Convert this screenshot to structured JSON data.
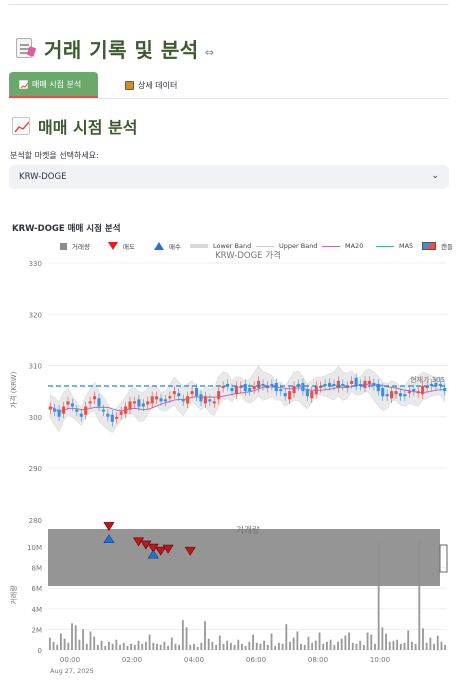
{
  "page": {
    "title": "거래 기록 및 분석",
    "title_link_icon": "link-icon"
  },
  "tabs": [
    {
      "label": "매매 시점 분석",
      "icon": "chart-up-icon",
      "active": true
    },
    {
      "label": "상세 데이터",
      "icon": "card-box-icon",
      "active": false
    }
  ],
  "section": {
    "heading": "매매 시점 분석",
    "icon": "chart-up-icon"
  },
  "market_select": {
    "label": "분석할 마켓을 선택하세요:",
    "value": "KRW-DOGE"
  },
  "chart": {
    "header": "KRW-DOGE 매매 시점 분석",
    "legend": [
      {
        "label": "거래량",
        "kind": "square",
        "color": "#8c8c8c"
      },
      {
        "label": "매도",
        "kind": "down-triangle",
        "color": "#e02020"
      },
      {
        "label": "매수",
        "kind": "up-triangle",
        "color": "#2a6fd6"
      },
      {
        "label": "Lower Band",
        "kind": "band",
        "color": "#d9d9d9"
      },
      {
        "label": "Upper Band",
        "kind": "line",
        "color": "#cccccc"
      },
      {
        "label": "MA20",
        "kind": "line",
        "color": "#b86cc7"
      },
      {
        "label": "MA5",
        "kind": "line",
        "color": "#4ab0a8"
      },
      {
        "label": "캔들",
        "kind": "candle",
        "color": "#2a6fd6"
      }
    ],
    "colors": {
      "up": "#e8514a",
      "down": "#3a8ee6",
      "current_price_line": "#2a82d4",
      "band_fill": "#e4e4e4",
      "volume_bar": "#9a9a9a",
      "volume_overlay": "#8f8f8f"
    }
  },
  "chart_data": [
    {
      "type": "candlestick",
      "title": "KRW-DOGE 가격",
      "ylabel": "가격 (KRW)",
      "ylim": [
        285,
        332
      ],
      "yticks": [
        290,
        300,
        310,
        320,
        330
      ],
      "current_price_label": "현재가 305",
      "current_price": 306,
      "series_close": [
        302,
        301,
        300,
        302,
        303,
        302,
        301,
        300,
        302,
        303,
        304,
        302,
        301,
        300,
        299,
        300,
        301,
        302,
        303,
        303,
        302,
        302,
        303,
        304,
        304,
        303,
        303,
        304,
        305,
        304,
        303,
        304,
        305,
        304,
        303,
        304,
        303,
        303,
        305,
        306,
        306,
        305,
        306,
        306,
        305,
        305,
        306,
        307,
        306,
        306,
        306,
        305,
        305,
        304,
        305,
        306,
        306,
        305,
        304,
        305,
        306,
        306,
        306,
        306,
        306,
        307,
        306,
        306,
        307,
        306,
        306,
        307,
        307,
        306,
        305,
        304,
        304,
        305,
        305,
        304,
        304,
        305,
        305,
        305,
        306,
        306,
        306,
        306,
        306,
        305
      ]
    },
    {
      "type": "bar",
      "title": "거래량",
      "ylabel": "거래량",
      "yticks": [
        "0",
        "2M",
        "4M",
        "6M",
        "8M",
        "10M"
      ],
      "ytick_values": [
        0,
        2,
        4,
        6,
        8,
        10
      ],
      "top_tick_label": "280",
      "unit": "M",
      "x_ticks": [
        "00:00",
        "02:00",
        "04:00",
        "06:00",
        "08:00",
        "10:00"
      ],
      "x_date": "Aug 27, 2025",
      "values": [
        1.2,
        0.8,
        0.5,
        1.6,
        1.1,
        0.7,
        2.6,
        2.4,
        1.0,
        2.0,
        0.6,
        1.8,
        1.3,
        0.5,
        0.9,
        0.4,
        0.8,
        0.6,
        1.0,
        0.5,
        0.7,
        0.4,
        0.6,
        0.5,
        0.9,
        0.6,
        0.8,
        1.5,
        0.7,
        0.6,
        0.5,
        0.8,
        0.4,
        1.2,
        0.6,
        0.5,
        2.9,
        2.2,
        0.5,
        0.6,
        0.3,
        0.7,
        2.8,
        1.1,
        0.8,
        0.5,
        1.4,
        0.6,
        0.9,
        0.7,
        0.5,
        1.0,
        0.6,
        0.4,
        0.8,
        1.5,
        0.7,
        0.6,
        0.9,
        0.5,
        1.6,
        0.4,
        0.7,
        0.6,
        2.5,
        0.8,
        1.2,
        1.8,
        0.6,
        0.5,
        1.3,
        0.7,
        0.9,
        1.7,
        0.6,
        0.8,
        1.0,
        0.5,
        0.8,
        1.1,
        1.4,
        1.7,
        0.7,
        0.6,
        0.9,
        0.5,
        1.7,
        1.5,
        0.6,
        10.5,
        2.2,
        1.6,
        0.8,
        0.9,
        1.0,
        0.6,
        0.7,
        1.9,
        0.8,
        0.6,
        10.5,
        2.1,
        0.7,
        1.2,
        0.6,
        1.4,
        0.8,
        0.5
      ],
      "buy_markers": [
        {
          "x_index": 16,
          "y": 10.8
        },
        {
          "x_index": 28,
          "y": 9.3
        }
      ],
      "sell_markers": [
        {
          "x_index": 16,
          "y": 12.0
        },
        {
          "x_index": 24,
          "y": 10.5
        },
        {
          "x_index": 26,
          "y": 10.2
        },
        {
          "x_index": 28,
          "y": 9.9
        },
        {
          "x_index": 30,
          "y": 9.6
        },
        {
          "x_index": 32,
          "y": 9.8
        },
        {
          "x_index": 38,
          "y": 9.6
        }
      ]
    }
  ]
}
